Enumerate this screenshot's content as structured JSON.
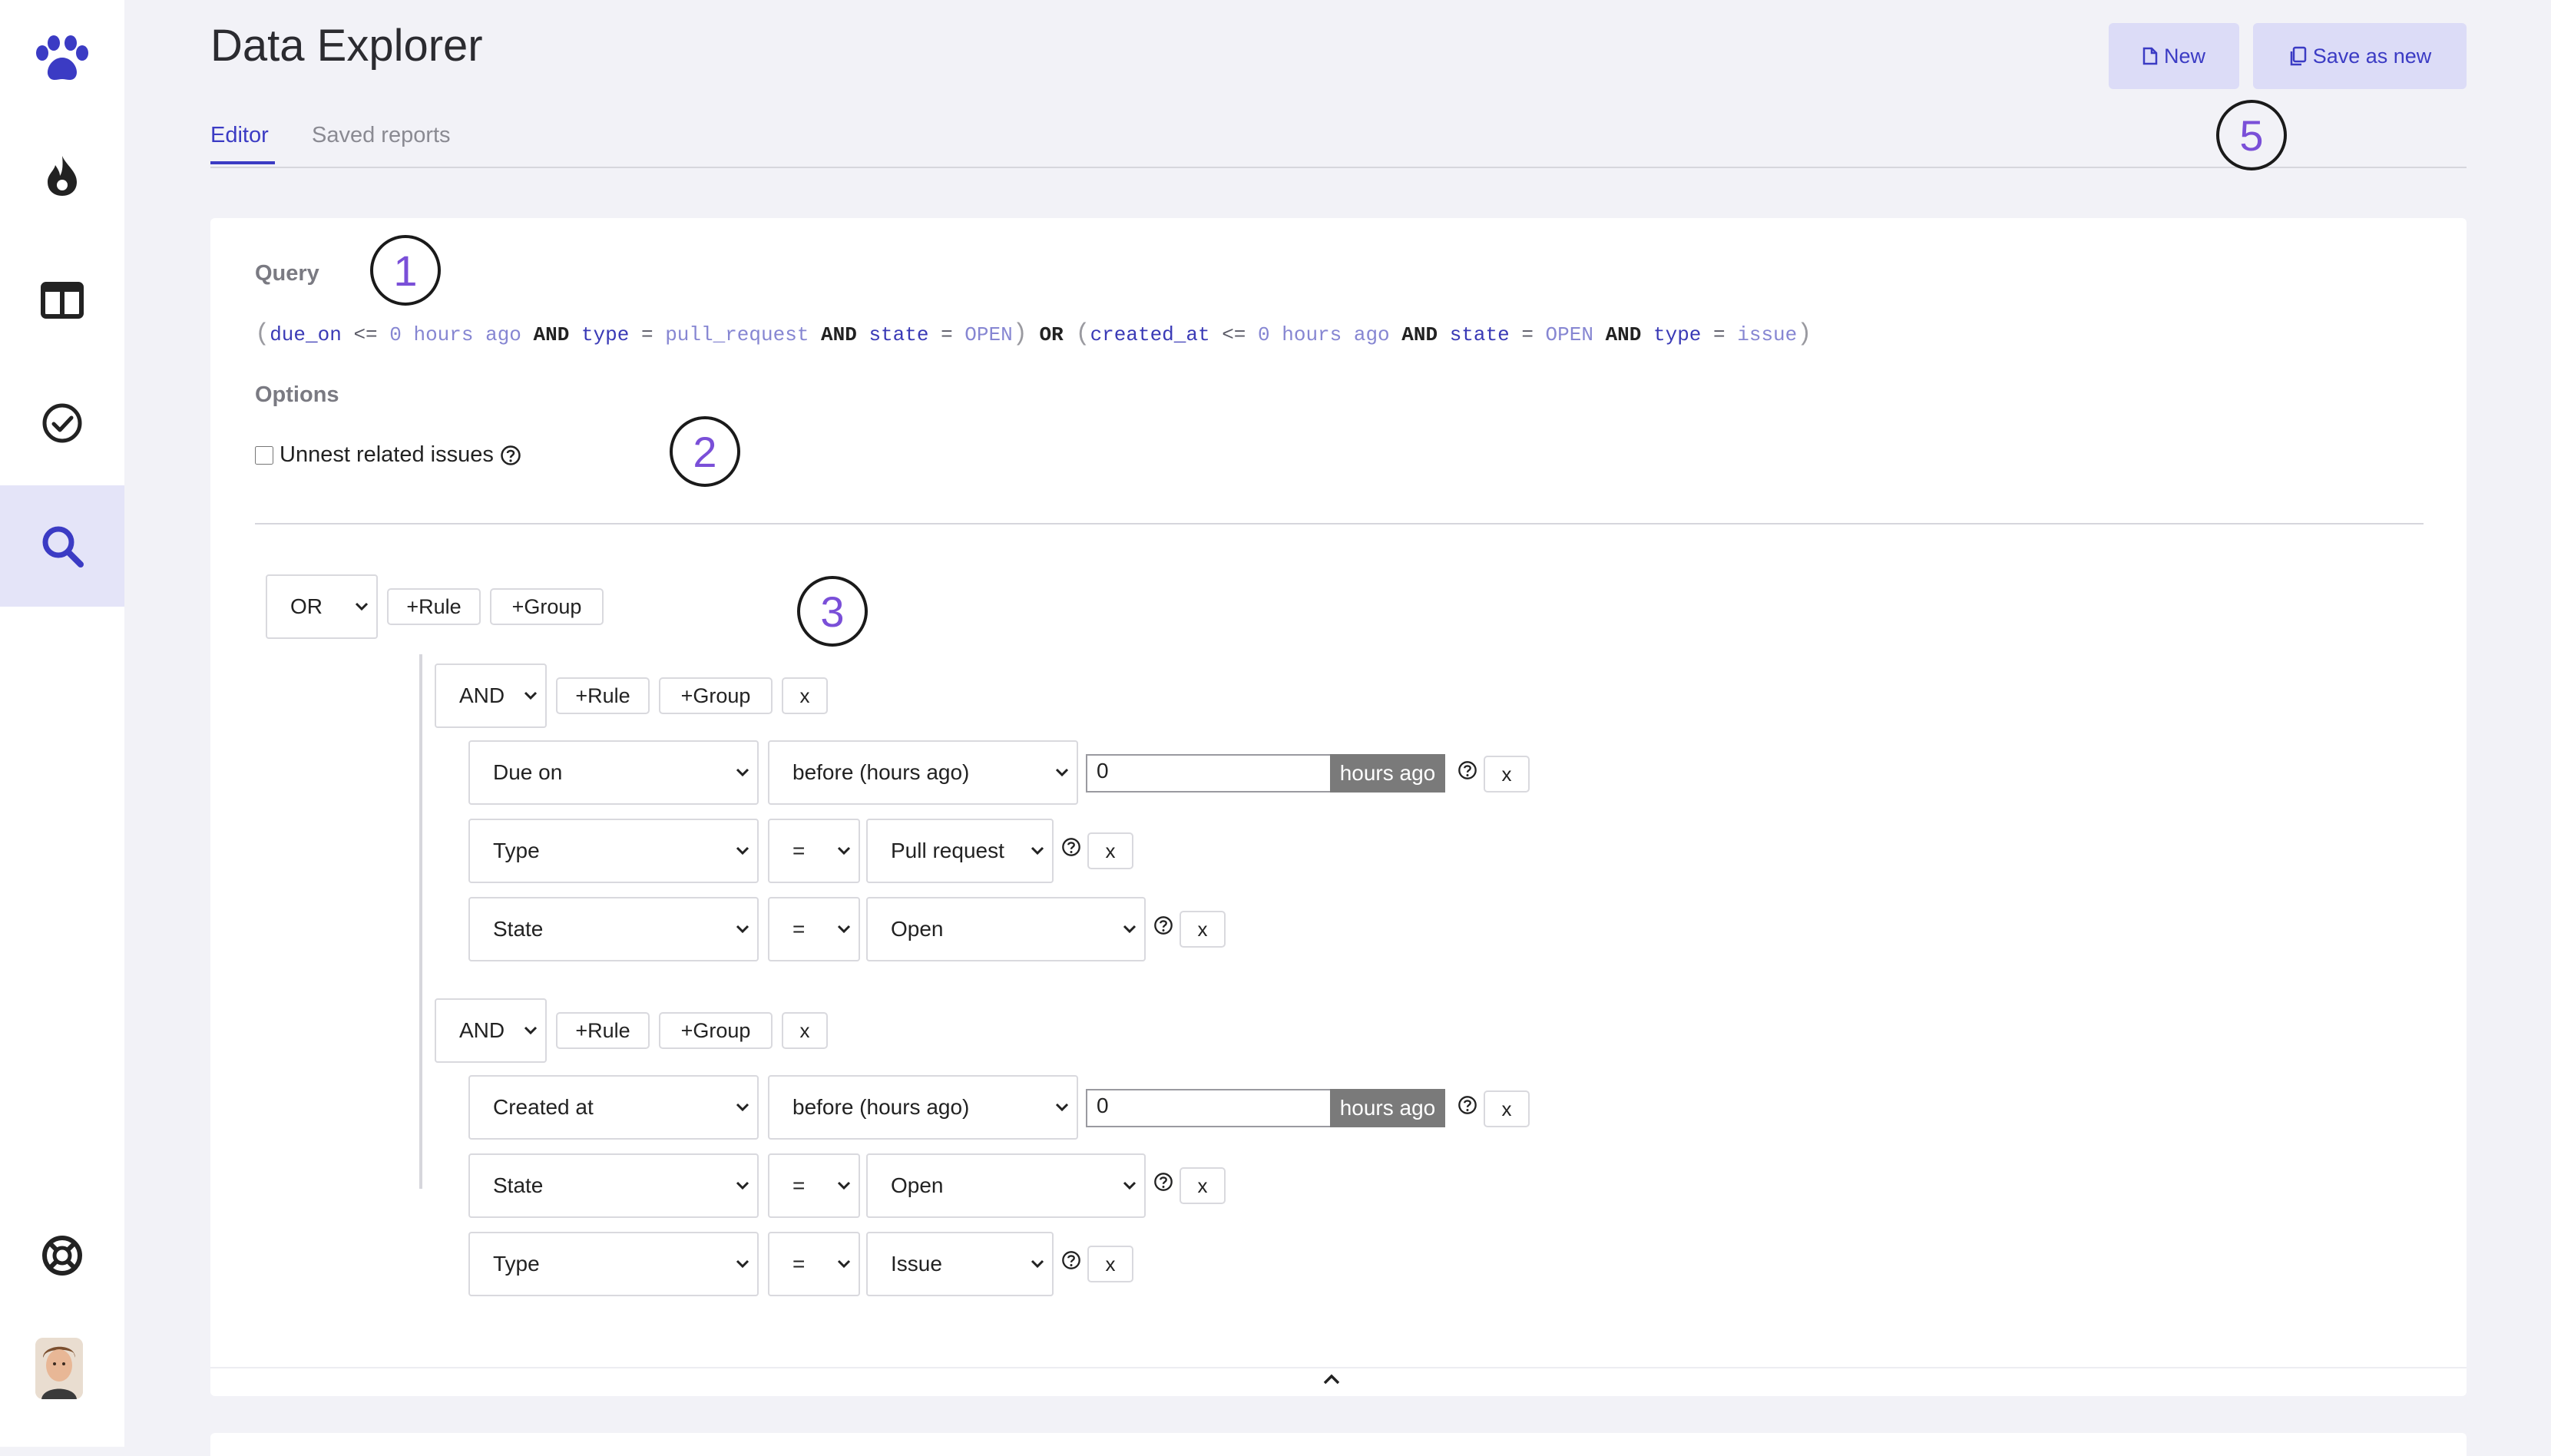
{
  "app": {
    "title": "Data Explorer",
    "tabs": [
      {
        "label": "Editor",
        "active": true
      },
      {
        "label": "Saved reports",
        "active": false
      }
    ],
    "accent": "#3b3bc4"
  },
  "header_buttons": {
    "new_label": "New",
    "save_as_new_label": "Save as new"
  },
  "sidebar": {
    "items": [
      {
        "icon": "paw-logo-icon"
      },
      {
        "icon": "flame-icon"
      },
      {
        "icon": "columns-icon"
      },
      {
        "icon": "check-circle-icon"
      },
      {
        "icon": "search-icon",
        "active": true
      }
    ],
    "bottom": [
      {
        "icon": "lifebuoy-icon"
      },
      {
        "icon": "user-avatar"
      }
    ]
  },
  "query": {
    "label": "Query",
    "tokens": [
      {
        "t": "(",
        "k": "paren"
      },
      {
        "t": "due_on",
        "k": "field"
      },
      {
        "t": "<=",
        "k": "op"
      },
      {
        "t": "0 hours ago",
        "k": "val"
      },
      {
        "t": "AND",
        "k": "kw"
      },
      {
        "t": "type",
        "k": "field"
      },
      {
        "t": "=",
        "k": "op"
      },
      {
        "t": "pull_request",
        "k": "val"
      },
      {
        "t": "AND",
        "k": "kw"
      },
      {
        "t": "state",
        "k": "field"
      },
      {
        "t": "=",
        "k": "op"
      },
      {
        "t": "OPEN",
        "k": "val"
      },
      {
        "t": ")",
        "k": "paren"
      },
      {
        "t": "OR",
        "k": "kw"
      },
      {
        "t": "(",
        "k": "paren"
      },
      {
        "t": "created_at",
        "k": "field"
      },
      {
        "t": "<=",
        "k": "op"
      },
      {
        "t": "0 hours ago",
        "k": "val"
      },
      {
        "t": "AND",
        "k": "kw"
      },
      {
        "t": "state",
        "k": "field"
      },
      {
        "t": "=",
        "k": "op"
      },
      {
        "t": "OPEN",
        "k": "val"
      },
      {
        "t": "AND",
        "k": "kw"
      },
      {
        "t": "type",
        "k": "field"
      },
      {
        "t": "=",
        "k": "op"
      },
      {
        "t": "issue",
        "k": "val"
      },
      {
        "t": ")",
        "k": "paren"
      }
    ]
  },
  "options": {
    "label": "Options",
    "unnest_label": "Unnest related issues",
    "unnest_checked": false
  },
  "builder": {
    "root_combinator": "OR",
    "add_rule_label": "+Rule",
    "add_group_label": "+Group",
    "remove_label": "x",
    "suffix_label": "hours ago",
    "group1": {
      "combinator": "AND",
      "rule1": {
        "field": "Due on",
        "operator": "before (hours ago)",
        "value": "0"
      },
      "rule2": {
        "field": "Type",
        "operator": "=",
        "value": "Pull request"
      },
      "rule3": {
        "field": "State",
        "operator": "=",
        "value": "Open"
      }
    },
    "group2": {
      "combinator": "AND",
      "rule1": {
        "field": "Created at",
        "operator": "before (hours ago)",
        "value": "0"
      },
      "rule2": {
        "field": "State",
        "operator": "=",
        "value": "Open"
      },
      "rule3": {
        "field": "Type",
        "operator": "=",
        "value": "Issue"
      }
    }
  },
  "annotations": [
    "1",
    "2",
    "3",
    "5"
  ]
}
